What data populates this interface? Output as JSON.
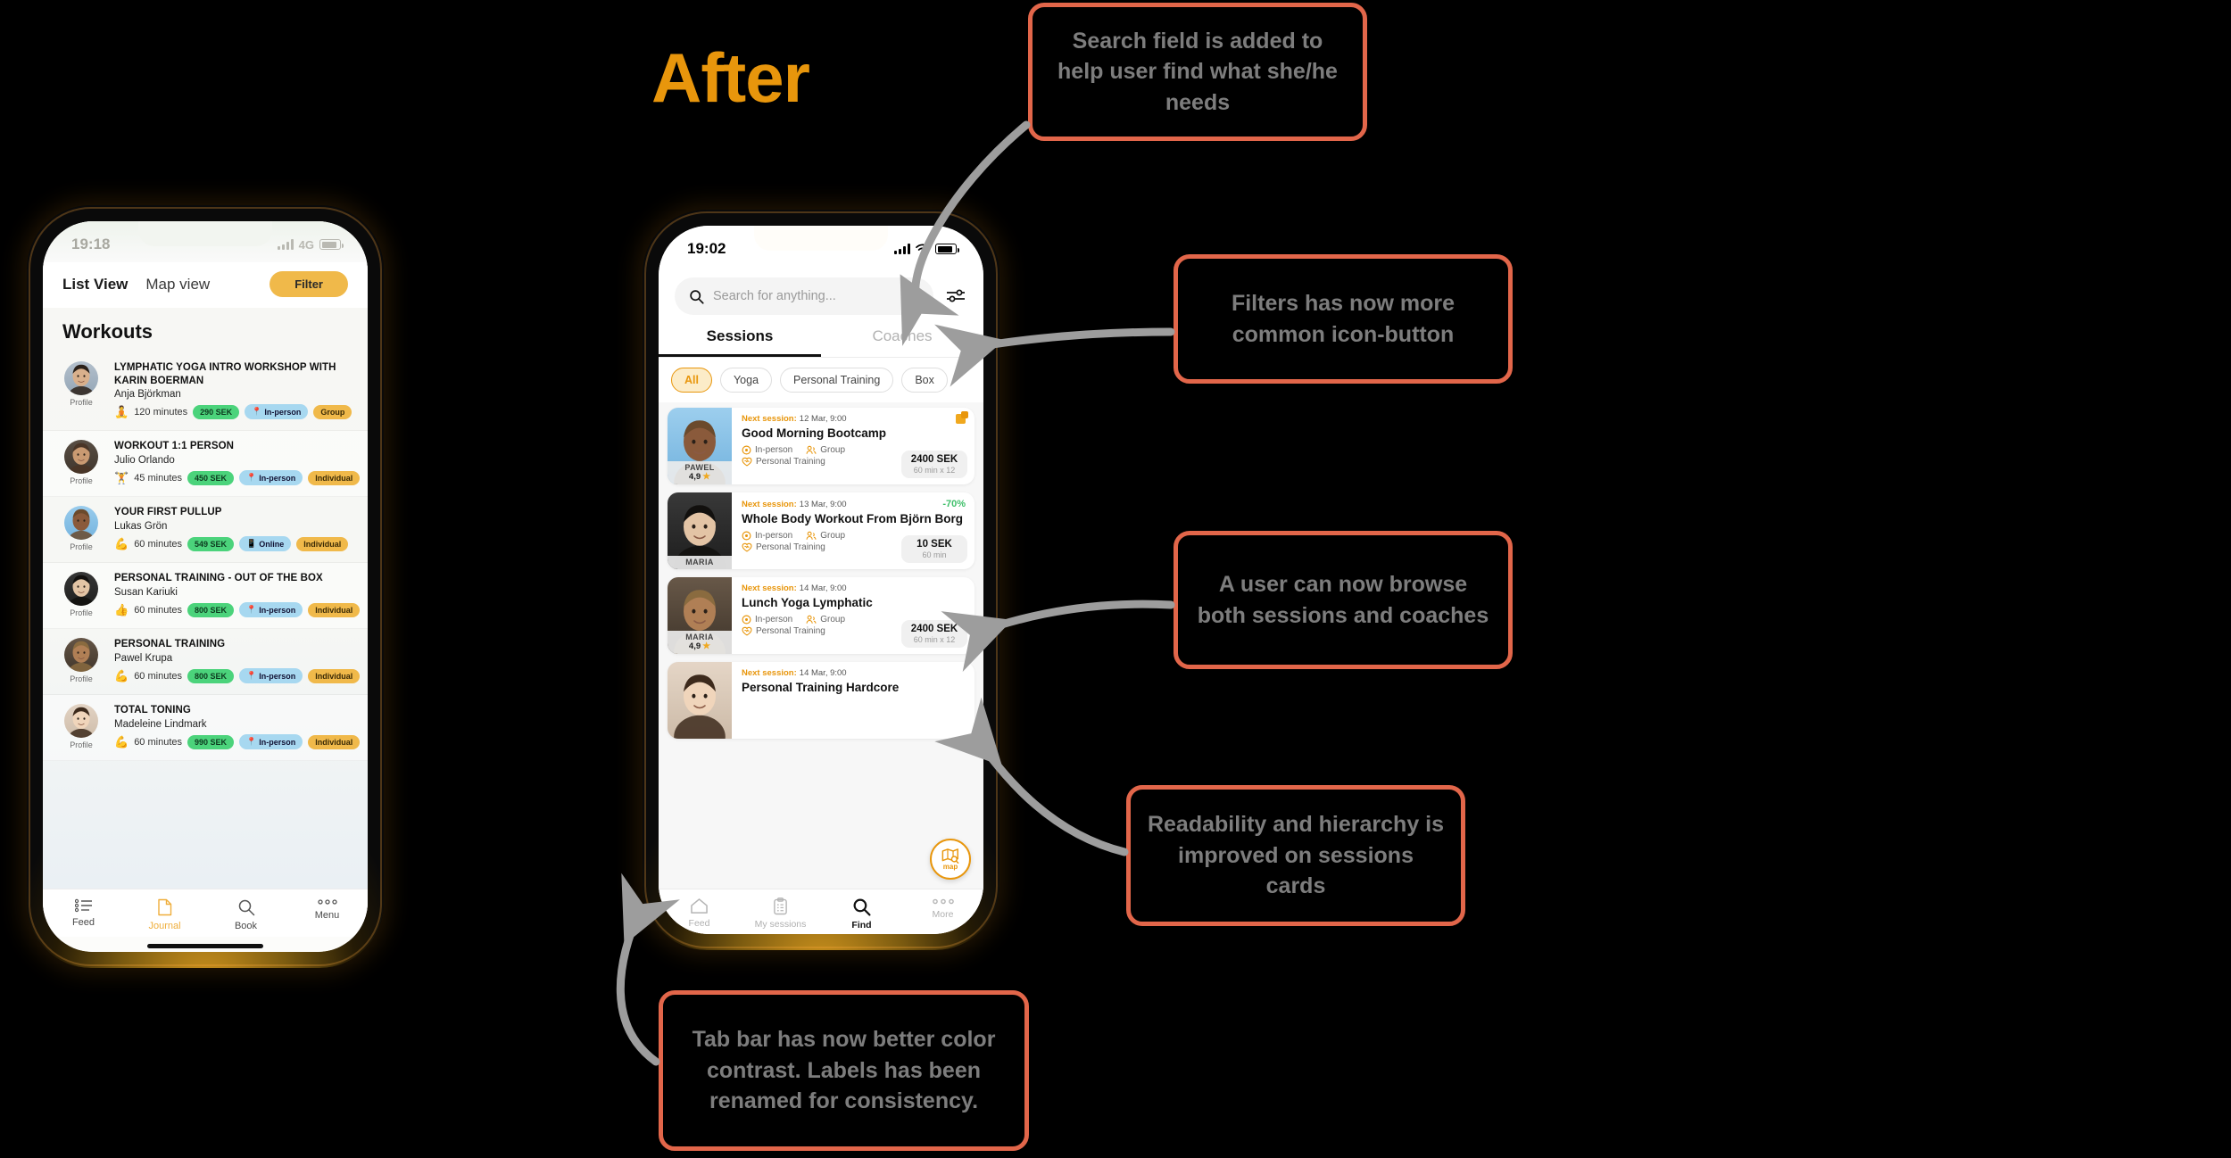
{
  "title": "After",
  "title_color": "#E8960C",
  "callouts": [
    {
      "id": "search",
      "text": "Search field is added to help user find what she/he needs"
    },
    {
      "id": "filter",
      "text": "Filters has now more common icon-button"
    },
    {
      "id": "browse",
      "text": "A user can now browse both sessions and coaches"
    },
    {
      "id": "read",
      "text": "Readability and hierarchy is improved on sessions cards"
    },
    {
      "id": "tabbar",
      "text": "Tab bar has now better color contrast. Labels has been renamed for consistency."
    }
  ],
  "before_phone": {
    "status": {
      "time": "19:18",
      "network": "4G"
    },
    "toolbar": {
      "list_view": "List View",
      "map_view": "Map view",
      "filter": "Filter"
    },
    "heading": "Workouts",
    "avatar_label": "Profile",
    "rows": [
      {
        "title": "LYMPHATIC YOGA INTRO WORKSHOP WITH KARIN BOERMAN",
        "coach": "Anja Björkman",
        "duration": "120 minutes",
        "duration_icon": "yoga-icon",
        "price": "290 SEK",
        "mode": "In-person",
        "mode_icon": "pin-icon",
        "type": "Group"
      },
      {
        "title": "WORKOUT 1:1 PERSON",
        "coach": "Julio  Orlando",
        "duration": "45 minutes",
        "duration_icon": "kettlebell-icon",
        "price": "450 SEK",
        "mode": "In-person",
        "mode_icon": "pin-icon",
        "type": "Individual"
      },
      {
        "title": "YOUR FIRST PULLUP",
        "coach": "Lukas Grön",
        "duration": "60 minutes",
        "duration_icon": "biceps-icon",
        "price": "549 SEK",
        "mode": "Online",
        "mode_icon": "phone-icon",
        "type": "Individual"
      },
      {
        "title": "PERSONAL TRAINING - OUT OF THE BOX",
        "coach": "Susan Kariuki",
        "duration": "60 minutes",
        "duration_icon": "thumb-icon",
        "price": "800 SEK",
        "mode": "In-person",
        "mode_icon": "pin-icon",
        "type": "Individual"
      },
      {
        "title": "PERSONAL TRAINING",
        "coach": "Pawel Krupa",
        "duration": "60 minutes",
        "duration_icon": "biceps-icon",
        "price": "800 SEK",
        "mode": "In-person",
        "mode_icon": "pin-icon",
        "type": "Individual"
      },
      {
        "title": "TOTAL TONING",
        "coach": "Madeleine  Lindmark",
        "duration": "60 minutes",
        "duration_icon": "biceps-icon",
        "price": "990 SEK",
        "mode": "In-person",
        "mode_icon": "pin-icon",
        "type": "Individual"
      }
    ],
    "tabbar": [
      {
        "label": "Feed",
        "icon": "list-icon",
        "active": false
      },
      {
        "label": "Journal",
        "icon": "journal-icon",
        "active": true
      },
      {
        "label": "Book",
        "icon": "search-icon",
        "active": false
      },
      {
        "label": "Menu",
        "icon": "ellipsis-icon",
        "active": false
      }
    ]
  },
  "after_phone": {
    "status": {
      "time": "19:02"
    },
    "search": {
      "placeholder": "Search for anything...",
      "icon": "search-icon",
      "filter_icon": "sliders-icon"
    },
    "tabs": [
      {
        "label": "Sessions",
        "active": true
      },
      {
        "label": "Coaches",
        "active": false
      }
    ],
    "chips": [
      {
        "label": "All",
        "active": true
      },
      {
        "label": "Yoga",
        "active": false
      },
      {
        "label": "Personal Training",
        "active": false
      },
      {
        "label": "Box",
        "active": false
      }
    ],
    "cards": [
      {
        "next_label": "Next session:",
        "next_value": "12 Mar, 9:00",
        "flag": "new-badge",
        "title": "Good Morning Bootcamp",
        "attr_mode": "In-person",
        "attr_group": "Group",
        "attr_type": "Personal Training",
        "price": "2400 SEK",
        "price_sub": "60 min x 12",
        "coach_name": "PAWEL",
        "coach_rating": "4,9"
      },
      {
        "next_label": "Next session:",
        "next_value": "13 Mar, 9:00",
        "discount": "-70%",
        "title": "Whole Body Workout From Björn Borg",
        "attr_mode": "In-person",
        "attr_group": "Group",
        "attr_type": "Personal Training",
        "price": "10 SEK",
        "price_sub": "60 min",
        "coach_name": "MARIA",
        "coach_rating": ""
      },
      {
        "next_label": "Next session:",
        "next_value": "14 Mar, 9:00",
        "title": "Lunch Yoga Lymphatic",
        "attr_mode": "In-person",
        "attr_group": "Group",
        "attr_type": "Personal Training",
        "price": "2400 SEK",
        "price_sub": "60 min x 12",
        "coach_name": "MARIA",
        "coach_rating": "4,9"
      },
      {
        "next_label": "Next session:",
        "next_value": "14 Mar, 9:00",
        "title": "Personal Training Hardcore",
        "attr_mode": "",
        "attr_group": "",
        "attr_type": "",
        "price": "",
        "price_sub": "",
        "coach_name": "",
        "coach_rating": ""
      }
    ],
    "map_fab": {
      "label": "map",
      "icon": "map-search-icon"
    },
    "tabbar": [
      {
        "label": "Feed",
        "icon": "home-icon",
        "active": false
      },
      {
        "label": "My sessions",
        "icon": "clipboard-icon",
        "active": false
      },
      {
        "label": "Find",
        "icon": "search-icon",
        "active": true
      },
      {
        "label": "More",
        "icon": "ellipsis-icon",
        "active": false
      }
    ]
  }
}
